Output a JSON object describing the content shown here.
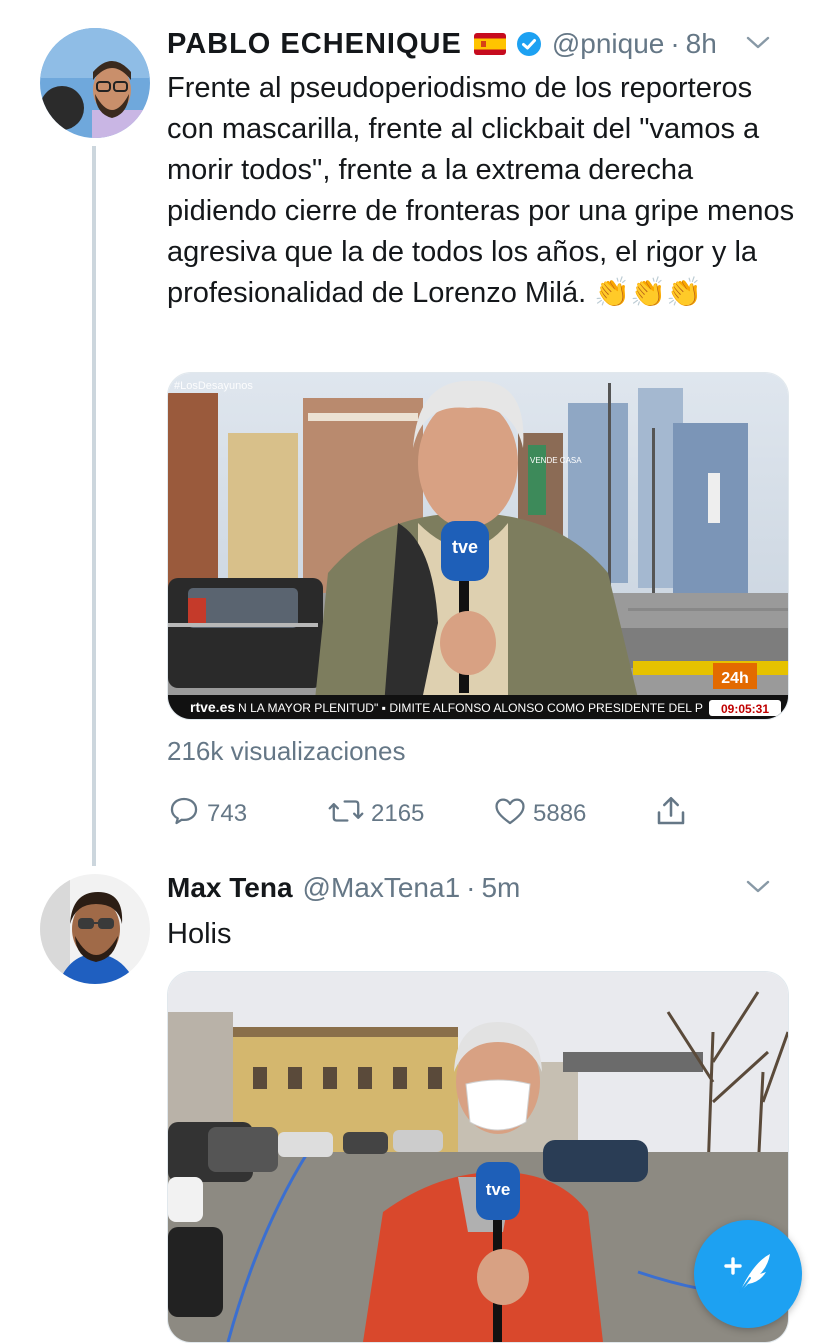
{
  "tweets": [
    {
      "author_name": "PABLO ECHENIQUE",
      "handle": "@pnique",
      "separator": "·",
      "time": "8h",
      "text": "Frente al pseudoperiodismo de los reporteros con mascarilla, frente al clickbait del \"vamos a morir todos\", frente a la extrema derecha pidiendo cierre de fronteras por una gripe menos agresiva que la de todos los años, el rigor y la profesionalidad de Lorenzo Milá. 👏👏👏",
      "media": {
        "watermark": "#LosDesayunos",
        "mic_label": "tve",
        "channel_badge": "24h",
        "ticker_brand": "rtve.es",
        "ticker_text": "N LA MAYOR PLENITUD\"  ▪  DIMITE ALFONSO ALONSO COMO PRESIDENTE DEL P",
        "ticker_time": "09:05:31",
        "sign_text": "VENDE CASA"
      },
      "views": "216k visualizaciones",
      "actions": {
        "replies": "743",
        "retweets": "2165",
        "likes": "5886"
      }
    },
    {
      "author_name": "Max Tena",
      "handle": "@MaxTena1",
      "separator": "·",
      "time": "5m",
      "text": "Holis",
      "media": {
        "mic_label": "tve"
      }
    }
  ],
  "colors": {
    "accent": "#1da1f2",
    "secondary_text": "#657786",
    "thread_line": "#ccd6dd"
  },
  "icons": [
    "chevron-down-icon",
    "verified-icon",
    "spain-flag-icon",
    "reply-icon",
    "retweet-icon",
    "like-icon",
    "share-icon",
    "compose-icon"
  ]
}
